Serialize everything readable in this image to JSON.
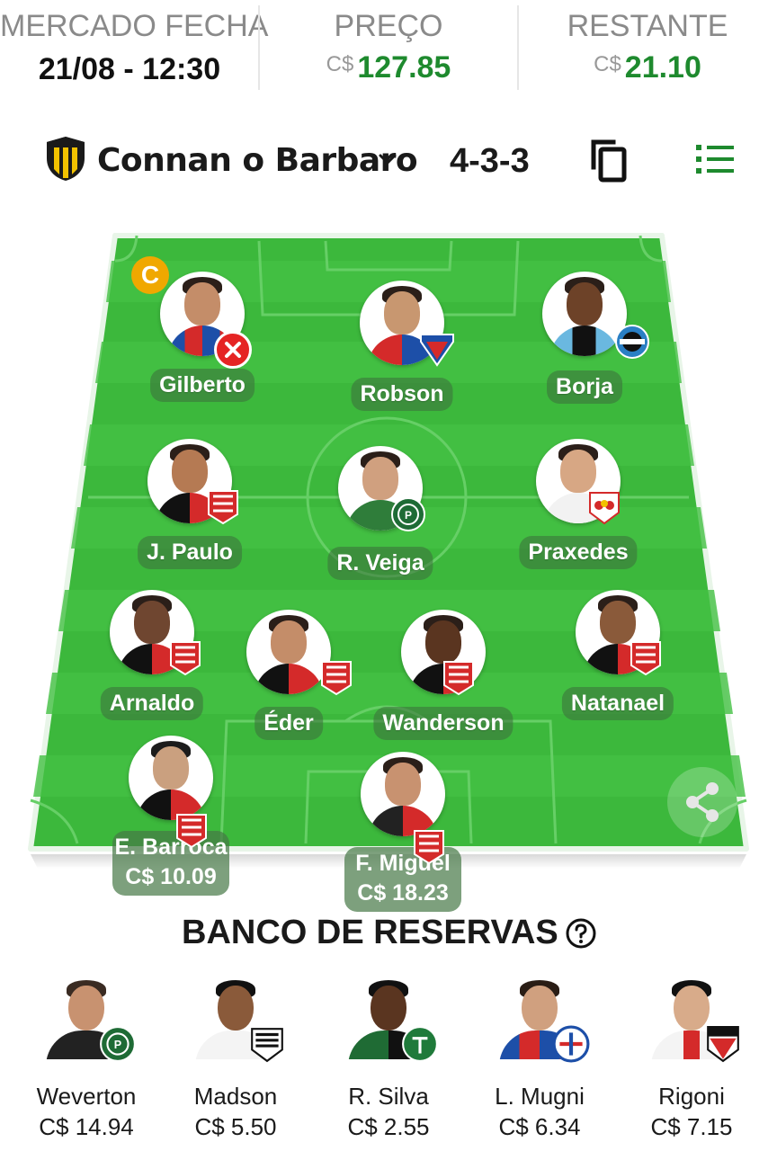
{
  "header": {
    "market": {
      "label": "MERCADO FECHA",
      "value": "21/08 - 12:30"
    },
    "price": {
      "label": "PREÇO",
      "currency": "C$",
      "value": "127.85"
    },
    "remaining": {
      "label": "RESTANTE",
      "currency": "C$",
      "value": "21.10"
    }
  },
  "team": {
    "name": "Connan o Barbaro",
    "formation": "4-3-3"
  },
  "pitch": {
    "captain_badge": "C",
    "players": [
      {
        "name": "Gilberto",
        "status": "injured",
        "captain": true
      },
      {
        "name": "Robson"
      },
      {
        "name": "Borja"
      },
      {
        "name": "J. Paulo"
      },
      {
        "name": "R. Veiga"
      },
      {
        "name": "Praxedes"
      },
      {
        "name": "Arnaldo"
      },
      {
        "name": "Éder"
      },
      {
        "name": "Wanderson"
      },
      {
        "name": "Natanael"
      },
      {
        "name": "E. Barroca",
        "price": "C$ 10.09"
      },
      {
        "name": "F. Miguel",
        "price": "C$ 18.23"
      }
    ]
  },
  "bench": {
    "title": "BANCO DE RESERVAS",
    "players": [
      {
        "name": "Weverton",
        "price": "C$ 14.94"
      },
      {
        "name": "Madson",
        "price": "C$ 5.50"
      },
      {
        "name": "R. Silva",
        "price": "C$ 2.55"
      },
      {
        "name": "L. Mugni",
        "price": "C$ 6.34"
      },
      {
        "name": "Rigoni",
        "price": "C$ 7.15"
      }
    ]
  },
  "colors": {
    "accent_green": "#1e8a2e",
    "pitch_green": "#3ab73a",
    "captain": "#f0a800",
    "injury": "#e52424"
  },
  "icons": [
    "team-crest-icon",
    "chevron-down-icon",
    "copy-icon",
    "list-icon",
    "share-icon",
    "help-icon"
  ]
}
